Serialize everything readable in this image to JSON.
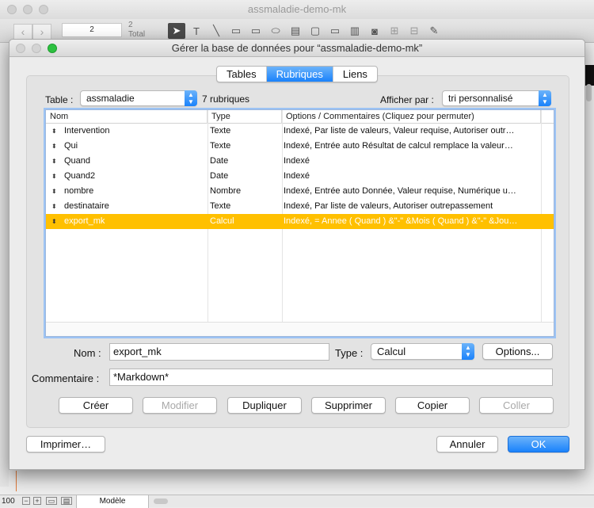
{
  "background": {
    "window_title": "assmaladie-demo-mk",
    "record_number": "2",
    "total_count": "2",
    "total_label": "Total",
    "zoom": "100",
    "mode": "Modèle"
  },
  "dialog": {
    "title": "Gérer la base de données pour “assmaladie-demo-mk”",
    "tabs": [
      {
        "label": "Tables",
        "active": false
      },
      {
        "label": "Rubriques",
        "active": true
      },
      {
        "label": "Liens",
        "active": false
      }
    ],
    "table_label": "Table :",
    "table_value": "assmaladie",
    "rubriques_count": "7 rubriques",
    "afficher_label": "Afficher par :",
    "afficher_value": "tri personnalisé",
    "columns": [
      "Nom",
      "Type",
      "Options / Commentaires   (Cliquez pour permuter)"
    ],
    "rows": [
      {
        "name": "Intervention",
        "type": "Texte",
        "options": "Indexé, Par liste de valeurs, Valeur requise, Autoriser outr…"
      },
      {
        "name": "Qui",
        "type": "Texte",
        "options": "Indexé, Entrée auto Résultat de calcul remplace la valeur…"
      },
      {
        "name": "Quand",
        "type": "Date",
        "options": "Indexé"
      },
      {
        "name": "Quand2",
        "type": "Date",
        "options": "Indexé"
      },
      {
        "name": "nombre",
        "type": "Nombre",
        "options": "Indexé, Entrée auto Donnée, Valeur requise, Numérique u…"
      },
      {
        "name": "destinataire",
        "type": "Texte",
        "options": "Indexé, Par liste de valeurs, Autoriser outrepassement"
      },
      {
        "name": "export_mk",
        "type": "Calcul",
        "options": "Indexé, = Annee ( Quand ) &\"-\" &Mois ( Quand ) &\"-\" &Jou…"
      }
    ],
    "selected_row": 6,
    "nom_label": "Nom :",
    "nom_value": "export_mk",
    "type_label": "Type :",
    "type_value": "Calcul",
    "options_button": "Options...",
    "commentaire_label": "Commentaire :",
    "commentaire_value": "*Markdown*",
    "actions": [
      {
        "label": "Créer",
        "enabled": true
      },
      {
        "label": "Modifier",
        "enabled": false
      },
      {
        "label": "Dupliquer",
        "enabled": true
      },
      {
        "label": "Supprimer",
        "enabled": true
      },
      {
        "label": "Copier",
        "enabled": true
      },
      {
        "label": "Coller",
        "enabled": false
      }
    ],
    "print_button": "Imprimer…",
    "cancel_button": "Annuler",
    "ok_button": "OK"
  },
  "colors": {
    "selection": "#ffc000",
    "accent": "#1a82fb"
  }
}
